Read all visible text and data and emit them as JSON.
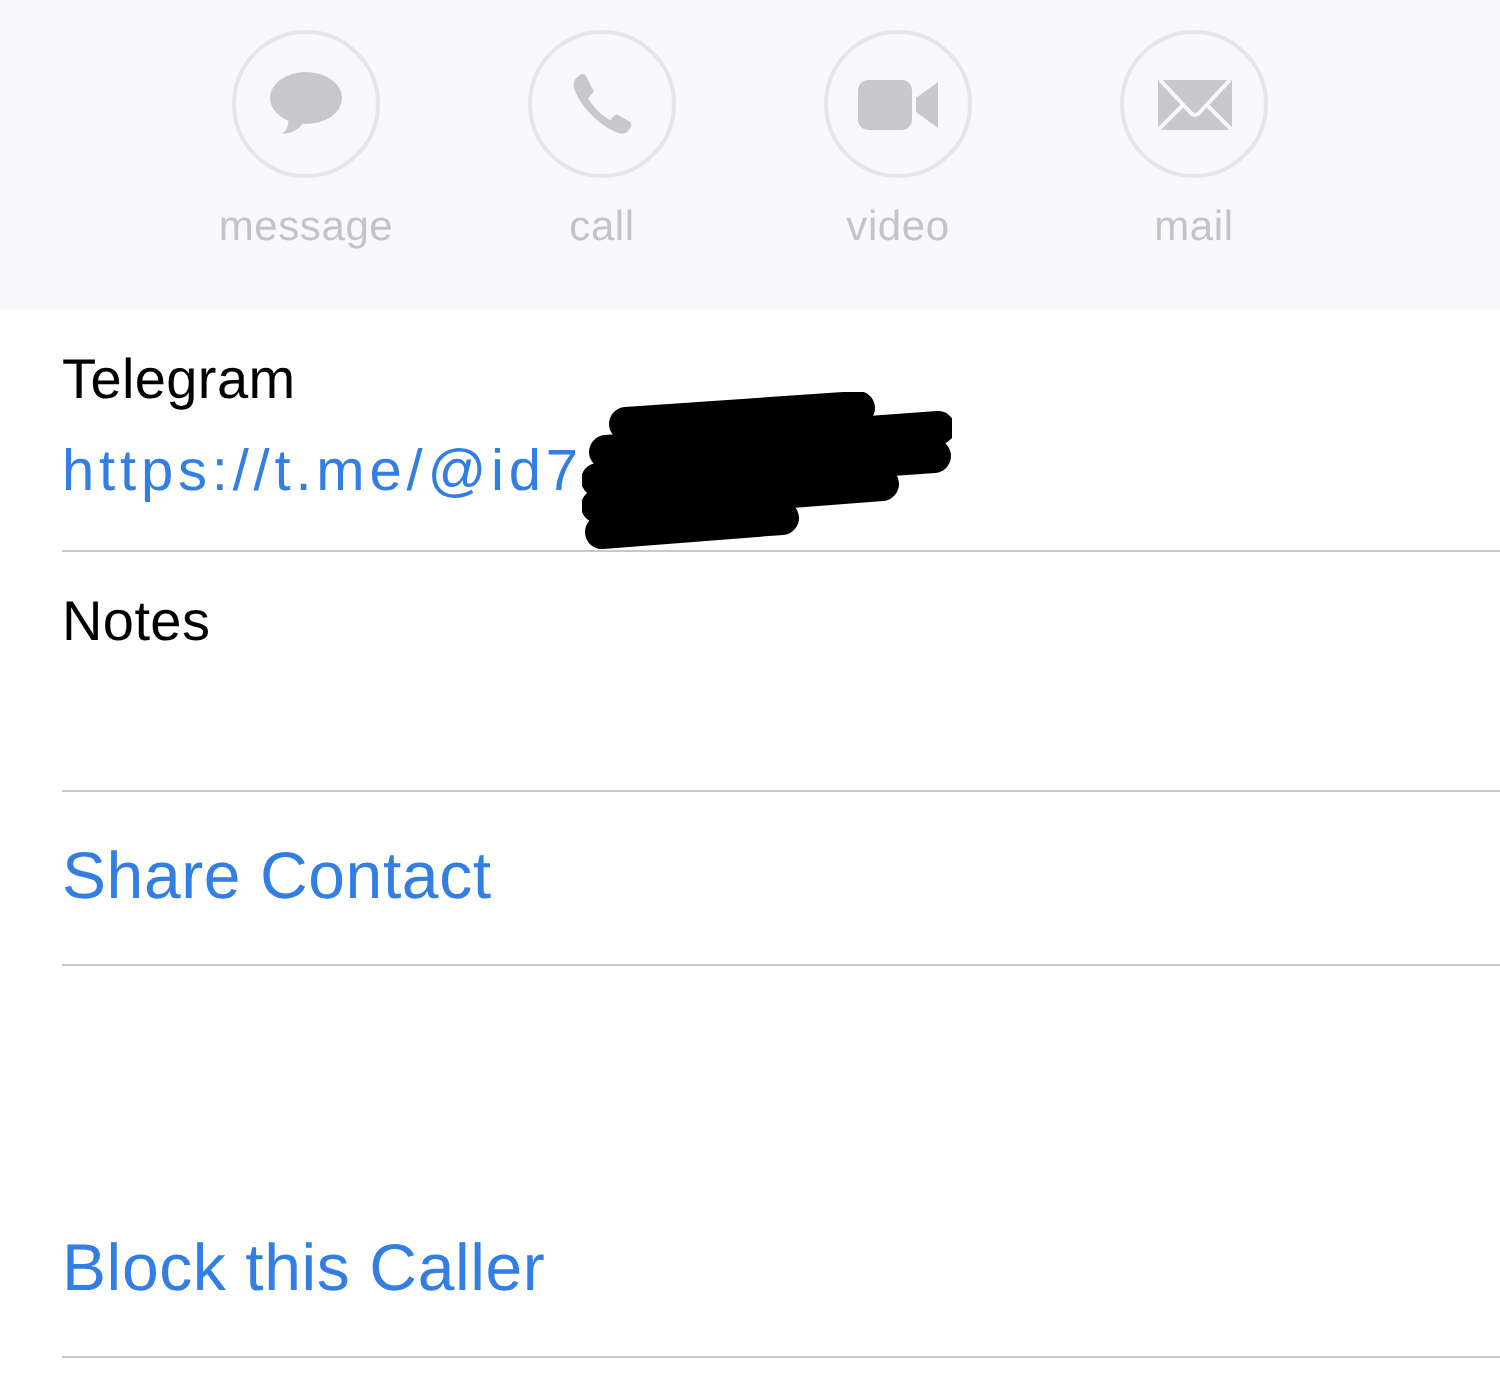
{
  "actions": [
    {
      "kind": "message",
      "label": "message",
      "disabled": true
    },
    {
      "kind": "call",
      "label": "call",
      "disabled": true
    },
    {
      "kind": "video",
      "label": "video",
      "disabled": true
    },
    {
      "kind": "mail",
      "label": "mail",
      "disabled": true
    }
  ],
  "fields": [
    {
      "kind": "link",
      "label": "Telegram",
      "value": "https://t.me/@id7",
      "redacted": true
    },
    {
      "kind": "notes",
      "label": "Notes"
    }
  ],
  "share_action": {
    "label": "Share Contact"
  },
  "block_action": {
    "label": "Block this Caller"
  }
}
